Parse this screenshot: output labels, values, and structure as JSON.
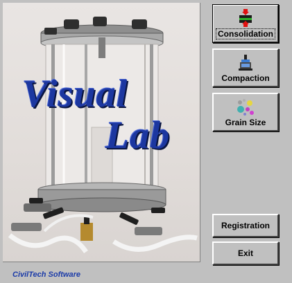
{
  "app": {
    "brand_line1": "Visual",
    "brand_line2": "Lab",
    "company": "CivilTech Software"
  },
  "buttons": {
    "consolidation": "Consolidation",
    "compaction": "Compaction",
    "grain_size": "Grain Size",
    "registration": "Registration",
    "exit": "Exit"
  },
  "icons": {
    "consolidation": "consolidation-cell-icon",
    "compaction": "compaction-mold-icon",
    "grain_size": "grain-size-particles-icon"
  },
  "colors": {
    "window_bg": "#c0c0c0",
    "brand_blue": "#1c37a0",
    "footer_blue": "#1a3aa8"
  }
}
